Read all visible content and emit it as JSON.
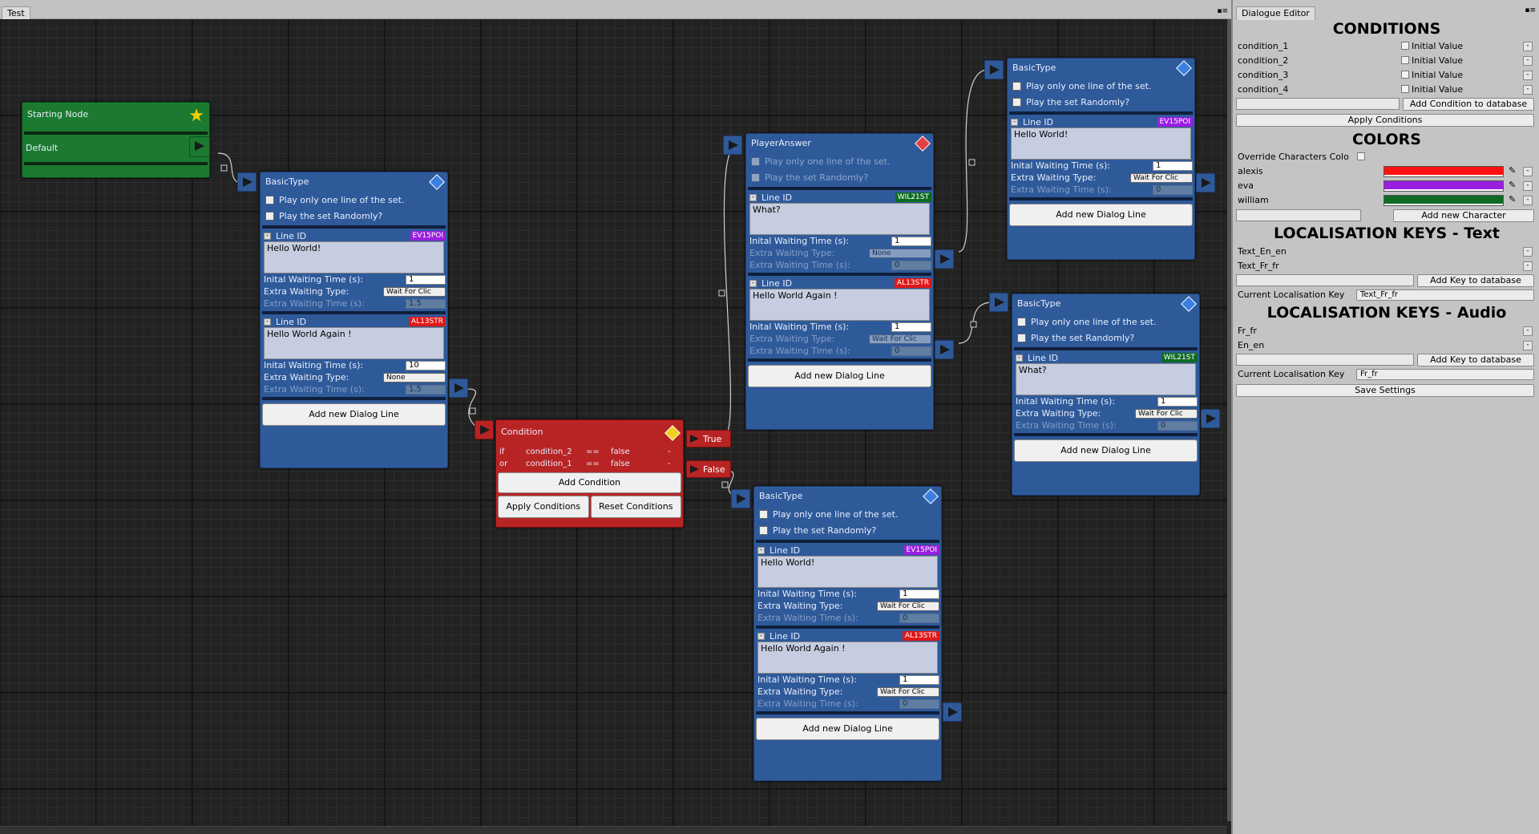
{
  "graph_tab": "Test",
  "panel_tab": "Dialogue Editor",
  "nodes": {
    "start": {
      "title": "Starting Node",
      "output": "Default"
    },
    "basic1": {
      "title": "BasicType",
      "opt1": "Play only one line of the set.",
      "opt2": "Play the set Randomly?",
      "lines": [
        {
          "label": "Line ID",
          "tag": "EV15POI",
          "text": "Hello World!",
          "wait_label": "Inital Waiting Time (s):",
          "wait": "1",
          "type_label": "Extra Waiting Type:",
          "type": "Wait For Clic",
          "extra_label": "Extra Waiting Time (s):",
          "extra": "1.5"
        },
        {
          "label": "Line ID",
          "tag": "AL13STR",
          "text": "Hello World Again !",
          "wait_label": "Inital Waiting Time (s):",
          "wait": "10",
          "type_label": "Extra Waiting Type:",
          "type": "None",
          "extra_label": "Extra Waiting Time (s):",
          "extra": "1.5"
        }
      ],
      "add_line": "Add new Dialog Line"
    },
    "condition": {
      "title": "Condition",
      "rows": [
        {
          "op": "if",
          "cond": "condition_2",
          "cmp": "==",
          "val": "false"
        },
        {
          "op": "or",
          "cond": "condition_1",
          "cmp": "==",
          "val": "false"
        }
      ],
      "add": "Add Condition",
      "apply": "Apply Conditions",
      "reset": "Reset Conditions",
      "true_label": "True",
      "false_label": "False"
    },
    "player": {
      "title": "PlayerAnswer",
      "opt1": "Play only one line of the set.",
      "opt2": "Play the set Randomly?",
      "lines": [
        {
          "label": "Line ID",
          "tag": "WIL21ST",
          "text": "What?",
          "wait_label": "Inital Waiting Time (s):",
          "wait": "1",
          "type_label": "Extra Waiting Type:",
          "type": "None",
          "extra_label": "Extra Waiting Time (s):",
          "extra": "0"
        },
        {
          "label": "Line ID",
          "tag": "AL13STR",
          "text": "Hello World Again !",
          "wait_label": "Inital Waiting Time (s):",
          "wait": "1",
          "type_label": "Extra Waiting Type:",
          "type": "Wait For Clic",
          "extra_label": "Extra Waiting Time (s):",
          "extra": "0"
        }
      ],
      "add_line": "Add new Dialog Line"
    },
    "basic2": {
      "title": "BasicType",
      "opt1": "Play only one line of the set.",
      "opt2": "Play the set Randomly?",
      "lines": [
        {
          "label": "Line ID",
          "tag": "EV15POI",
          "text": "Hello World!",
          "wait_label": "Inital Waiting Time (s):",
          "wait": "1",
          "type_label": "Extra Waiting Type:",
          "type": "Wait For Clic",
          "extra_label": "Extra Waiting Time (s):",
          "extra": "0"
        }
      ],
      "add_line": "Add new Dialog Line"
    },
    "basic3": {
      "title": "BasicType",
      "opt1": "Play only one line of the set.",
      "opt2": "Play the set Randomly?",
      "lines": [
        {
          "label": "Line ID",
          "tag": "WIL21ST",
          "text": "What?",
          "wait_label": "Inital Waiting Time (s):",
          "wait": "1",
          "type_label": "Extra Waiting Type:",
          "type": "Wait For Clic",
          "extra_label": "Extra Waiting Time (s):",
          "extra": "0"
        }
      ],
      "add_line": "Add new Dialog Line"
    },
    "basic4": {
      "title": "BasicType",
      "opt1": "Play only one line of the set.",
      "opt2": "Play the set Randomly?",
      "lines": [
        {
          "label": "Line ID",
          "tag": "EV15POI",
          "text": "Hello World!",
          "wait_label": "Inital Waiting Time (s):",
          "wait": "1",
          "type_label": "Extra Waiting Type:",
          "type": "Wait For Clic",
          "extra_label": "Extra Waiting Time (s):",
          "extra": "0"
        },
        {
          "label": "Line ID",
          "tag": "AL13STR",
          "text": "Hello World Again !",
          "wait_label": "Inital Waiting Time (s):",
          "wait": "1",
          "type_label": "Extra Waiting Type:",
          "type": "Wait For Clic",
          "extra_label": "Extra Waiting Time (s):",
          "extra": "0"
        }
      ],
      "add_line": "Add new Dialog Line"
    }
  },
  "tag_colors": {
    "EV15POI": "#9a1ee0",
    "AL13STR": "#e01818",
    "WIL21ST": "#0e6b24"
  },
  "panel": {
    "conditions_title": "CONDITIONS",
    "conditions": [
      "condition_1",
      "condition_2",
      "condition_3",
      "condition_4"
    ],
    "initial_value": "Initial Value",
    "add_condition": "Add Condition to database",
    "apply_conditions": "Apply Conditions",
    "colors_title": "COLORS",
    "override": "Override Characters Colo",
    "characters": [
      {
        "name": "alexis",
        "color": "#ff1010"
      },
      {
        "name": "eva",
        "color": "#9a1ee0"
      },
      {
        "name": "william",
        "color": "#0e6b24"
      }
    ],
    "add_character": "Add new Character",
    "loc_text_title": "LOCALISATION KEYS - Text",
    "text_keys": [
      "Text_En_en",
      "Text_Fr_fr"
    ],
    "add_key": "Add Key to database",
    "current_key_label": "Current Localisation Key",
    "current_text_key": "Text_Fr_fr",
    "loc_audio_title": "LOCALISATION KEYS - Audio",
    "audio_keys": [
      "Fr_fr",
      "En_en"
    ],
    "current_audio_key": "Fr_fr",
    "save": "Save Settings"
  }
}
